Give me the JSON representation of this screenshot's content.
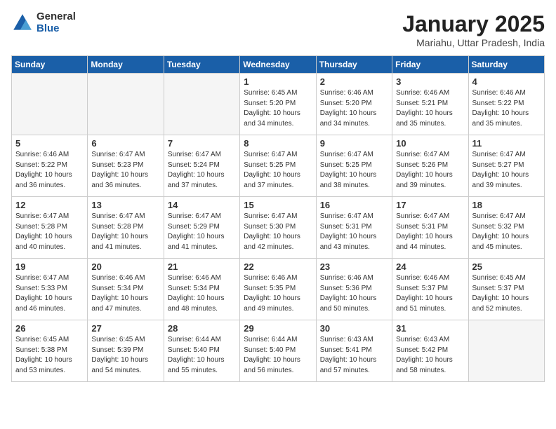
{
  "header": {
    "logo_general": "General",
    "logo_blue": "Blue",
    "month_title": "January 2025",
    "location": "Mariahu, Uttar Pradesh, India"
  },
  "days_of_week": [
    "Sunday",
    "Monday",
    "Tuesday",
    "Wednesday",
    "Thursday",
    "Friday",
    "Saturday"
  ],
  "weeks": [
    [
      {
        "day": "",
        "info": ""
      },
      {
        "day": "",
        "info": ""
      },
      {
        "day": "",
        "info": ""
      },
      {
        "day": "1",
        "info": "Sunrise: 6:45 AM\nSunset: 5:20 PM\nDaylight: 10 hours\nand 34 minutes."
      },
      {
        "day": "2",
        "info": "Sunrise: 6:46 AM\nSunset: 5:20 PM\nDaylight: 10 hours\nand 34 minutes."
      },
      {
        "day": "3",
        "info": "Sunrise: 6:46 AM\nSunset: 5:21 PM\nDaylight: 10 hours\nand 35 minutes."
      },
      {
        "day": "4",
        "info": "Sunrise: 6:46 AM\nSunset: 5:22 PM\nDaylight: 10 hours\nand 35 minutes."
      }
    ],
    [
      {
        "day": "5",
        "info": "Sunrise: 6:46 AM\nSunset: 5:22 PM\nDaylight: 10 hours\nand 36 minutes."
      },
      {
        "day": "6",
        "info": "Sunrise: 6:47 AM\nSunset: 5:23 PM\nDaylight: 10 hours\nand 36 minutes."
      },
      {
        "day": "7",
        "info": "Sunrise: 6:47 AM\nSunset: 5:24 PM\nDaylight: 10 hours\nand 37 minutes."
      },
      {
        "day": "8",
        "info": "Sunrise: 6:47 AM\nSunset: 5:25 PM\nDaylight: 10 hours\nand 37 minutes."
      },
      {
        "day": "9",
        "info": "Sunrise: 6:47 AM\nSunset: 5:25 PM\nDaylight: 10 hours\nand 38 minutes."
      },
      {
        "day": "10",
        "info": "Sunrise: 6:47 AM\nSunset: 5:26 PM\nDaylight: 10 hours\nand 39 minutes."
      },
      {
        "day": "11",
        "info": "Sunrise: 6:47 AM\nSunset: 5:27 PM\nDaylight: 10 hours\nand 39 minutes."
      }
    ],
    [
      {
        "day": "12",
        "info": "Sunrise: 6:47 AM\nSunset: 5:28 PM\nDaylight: 10 hours\nand 40 minutes."
      },
      {
        "day": "13",
        "info": "Sunrise: 6:47 AM\nSunset: 5:28 PM\nDaylight: 10 hours\nand 41 minutes."
      },
      {
        "day": "14",
        "info": "Sunrise: 6:47 AM\nSunset: 5:29 PM\nDaylight: 10 hours\nand 41 minutes."
      },
      {
        "day": "15",
        "info": "Sunrise: 6:47 AM\nSunset: 5:30 PM\nDaylight: 10 hours\nand 42 minutes."
      },
      {
        "day": "16",
        "info": "Sunrise: 6:47 AM\nSunset: 5:31 PM\nDaylight: 10 hours\nand 43 minutes."
      },
      {
        "day": "17",
        "info": "Sunrise: 6:47 AM\nSunset: 5:31 PM\nDaylight: 10 hours\nand 44 minutes."
      },
      {
        "day": "18",
        "info": "Sunrise: 6:47 AM\nSunset: 5:32 PM\nDaylight: 10 hours\nand 45 minutes."
      }
    ],
    [
      {
        "day": "19",
        "info": "Sunrise: 6:47 AM\nSunset: 5:33 PM\nDaylight: 10 hours\nand 46 minutes."
      },
      {
        "day": "20",
        "info": "Sunrise: 6:46 AM\nSunset: 5:34 PM\nDaylight: 10 hours\nand 47 minutes."
      },
      {
        "day": "21",
        "info": "Sunrise: 6:46 AM\nSunset: 5:34 PM\nDaylight: 10 hours\nand 48 minutes."
      },
      {
        "day": "22",
        "info": "Sunrise: 6:46 AM\nSunset: 5:35 PM\nDaylight: 10 hours\nand 49 minutes."
      },
      {
        "day": "23",
        "info": "Sunrise: 6:46 AM\nSunset: 5:36 PM\nDaylight: 10 hours\nand 50 minutes."
      },
      {
        "day": "24",
        "info": "Sunrise: 6:46 AM\nSunset: 5:37 PM\nDaylight: 10 hours\nand 51 minutes."
      },
      {
        "day": "25",
        "info": "Sunrise: 6:45 AM\nSunset: 5:37 PM\nDaylight: 10 hours\nand 52 minutes."
      }
    ],
    [
      {
        "day": "26",
        "info": "Sunrise: 6:45 AM\nSunset: 5:38 PM\nDaylight: 10 hours\nand 53 minutes."
      },
      {
        "day": "27",
        "info": "Sunrise: 6:45 AM\nSunset: 5:39 PM\nDaylight: 10 hours\nand 54 minutes."
      },
      {
        "day": "28",
        "info": "Sunrise: 6:44 AM\nSunset: 5:40 PM\nDaylight: 10 hours\nand 55 minutes."
      },
      {
        "day": "29",
        "info": "Sunrise: 6:44 AM\nSunset: 5:40 PM\nDaylight: 10 hours\nand 56 minutes."
      },
      {
        "day": "30",
        "info": "Sunrise: 6:43 AM\nSunset: 5:41 PM\nDaylight: 10 hours\nand 57 minutes."
      },
      {
        "day": "31",
        "info": "Sunrise: 6:43 AM\nSunset: 5:42 PM\nDaylight: 10 hours\nand 58 minutes."
      },
      {
        "day": "",
        "info": ""
      }
    ]
  ]
}
